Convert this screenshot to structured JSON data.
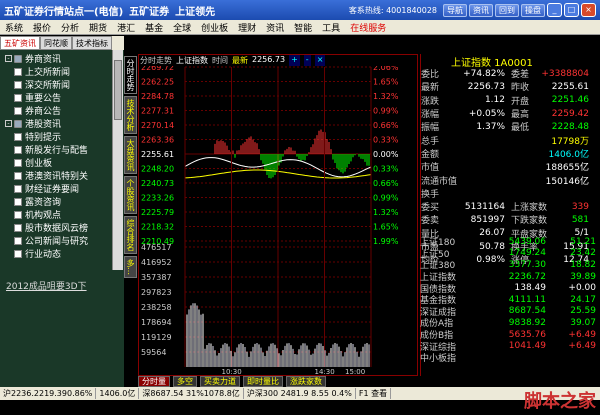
{
  "window": {
    "title_parts": [
      "五矿证券行情站点一(电信)",
      "五矿证券",
      "上证领先"
    ],
    "customer_label": "客系热线: 4001840028",
    "buttons": [
      "导航",
      "资讯",
      "回到",
      "操盘"
    ],
    "controls": [
      "minimize",
      "maximize",
      "close"
    ]
  },
  "menu": [
    "系统",
    "报价",
    "分析",
    "期货",
    "港汇",
    "基金",
    "全球",
    "创业板",
    "理财",
    "资讯",
    "智能",
    "工具",
    "在线服务"
  ],
  "sidebar": {
    "tabs": [
      "五矿资讯",
      "同花顺",
      "技术指标"
    ],
    "items": [
      {
        "label": "券商资讯",
        "type": "group"
      },
      {
        "label": "上交所新闻",
        "type": "sub"
      },
      {
        "label": "深交所新闻",
        "type": "sub"
      },
      {
        "label": "重要公告",
        "type": "sub"
      },
      {
        "label": "券商公告",
        "type": "sub"
      },
      {
        "label": "港股资讯",
        "type": "group"
      },
      {
        "label": "特别提示",
        "type": "sub"
      },
      {
        "label": "新股发行与配售",
        "type": "sub"
      },
      {
        "label": "创业板",
        "type": "sub"
      },
      {
        "label": "港澳资讯特别关",
        "type": "sub"
      },
      {
        "label": "财经证券要闻",
        "type": "sub"
      },
      {
        "label": "露资咨询",
        "type": "sub"
      },
      {
        "label": "机构观点",
        "type": "sub"
      },
      {
        "label": "股市数据风云榜",
        "type": "sub"
      },
      {
        "label": "公司新闻与研究",
        "type": "sub"
      },
      {
        "label": "行业动态",
        "type": "sub"
      }
    ],
    "footer_link": "2012成品咀要3D下"
  },
  "vertical_tabs": [
    "分时走势",
    "技术分析",
    "大盘资讯",
    "个股资讯",
    "综合排名",
    "多…"
  ],
  "chart_header": {
    "label1": "分时走势",
    "symbol": "上证指数",
    "time": "时间",
    "value_label": "最新",
    "value": "2256.73",
    "buttons": [
      "+",
      "-",
      "×"
    ]
  },
  "chart_data": {
    "type": "line",
    "y_ticks_price": [
      "2269.72",
      "2262.25",
      "2284.78",
      "2277.31",
      "2270.14",
      "2263.36",
      "2255.61",
      "2248.20",
      "2240.73",
      "2233.26",
      "2225.79",
      "2218.32",
      "2210.49"
    ],
    "y_ticks_pct": [
      "2.06%",
      "1.65%",
      "1.32%",
      "0.99%",
      "0.66%",
      "0.33%",
      "0.00%",
      "0.33%",
      "0.66%",
      "0.99%",
      "1.32%",
      "1.65%",
      "1.99%"
    ],
    "vol_ticks": [
      "476517",
      "416952",
      "357387",
      "297823",
      "238258",
      "178694",
      "119129",
      "59564"
    ],
    "x_ticks": [
      "10:30",
      "14:30",
      "15:00"
    ],
    "base_price": 2255.61
  },
  "bottom_tabs": [
    "分时量",
    "多空",
    "买卖力道",
    "即时量比",
    "涨跌家数"
  ],
  "quote": {
    "title": "上证指数 1A0001",
    "rows": [
      {
        "k": "委比",
        "v": "+74.82%",
        "v_color": "red",
        "k2": "委差",
        "v2": "+3388804",
        "v2_color": "red"
      },
      {
        "k": "最新",
        "v": "2256.73",
        "v_color": "white",
        "k2": "昨收",
        "v2": "2255.61",
        "v2_color": "white"
      },
      {
        "k": "涨跌",
        "v": "1.12",
        "v_color": "red",
        "k2": "开盘",
        "v2": "2251.46",
        "v2_color": "green"
      },
      {
        "k": "涨幅",
        "v": "+0.05%",
        "v_color": "red",
        "k2": "最高",
        "v2": "2259.42",
        "v2_color": "red"
      },
      {
        "k": "振幅",
        "v": "1.37%",
        "v_color": "white",
        "k2": "最低",
        "v2": "2228.48",
        "v2_color": "green"
      },
      {
        "k": "总手",
        "v": "",
        "v_color": "white",
        "k2": "",
        "v2": "17798万",
        "v2_color": "yel"
      },
      {
        "k": "金额",
        "v": "",
        "v_color": "white",
        "k2": "",
        "v2": "1406.0亿",
        "v2_color": "cyan"
      },
      {
        "k": "市值",
        "v": "",
        "v_color": "white",
        "k2": "",
        "v2": "188655亿",
        "v2_color": "white"
      },
      {
        "k": "流通市值",
        "v": "",
        "v_color": "white",
        "k2": "",
        "v2": "150146亿",
        "v2_color": "white"
      },
      {
        "k": "换手",
        "v": "",
        "v_color": "white",
        "k2": "",
        "v2": "",
        "v2_color": "white"
      },
      {
        "k": "委买",
        "v": "5131164",
        "v_color": "yel",
        "k2": "上涨家数",
        "v2": "339",
        "v2_color": "red"
      },
      {
        "k": "委卖",
        "v": "851997",
        "v_color": "yel",
        "k2": "下跌家数",
        "v2": "581",
        "v2_color": "green"
      },
      {
        "k": "量比",
        "v": "26.07",
        "v_color": "cyan",
        "k2": "平盘家数",
        "v2": "5/1",
        "v2_color": "white"
      },
      {
        "k": "市盈",
        "v": "50.78",
        "v_color": "cyan",
        "k2": "换手率",
        "v2": "15.91",
        "v2_color": "white"
      },
      {
        "k": "均价",
        "v": "0.98%",
        "v_color": "white",
        "k2": "涨停",
        "v2": "12.74",
        "v2_color": "white"
      }
    ]
  },
  "index_list": [
    {
      "n": "上证180",
      "p": "5439.06",
      "c": "51.21",
      "color": "green"
    },
    {
      "n": "上证50",
      "p": "1749.24",
      "c": "23.42",
      "color": "green"
    },
    {
      "n": "上证380",
      "p": "3377.30",
      "c": "18.82",
      "color": "green"
    },
    {
      "n": "上证指数",
      "p": "2236.72",
      "c": "39.89",
      "color": "green"
    },
    {
      "n": "国债指数",
      "p": "138.49",
      "c": "+0.00",
      "color": "white"
    },
    {
      "n": "基金指数",
      "p": "4111.11",
      "c": "24.17",
      "color": "green"
    },
    {
      "n": "深证成指",
      "p": "8687.54",
      "c": "25.59",
      "color": "green"
    },
    {
      "n": "成份A指",
      "p": "9838.92",
      "c": "39.07",
      "color": "green"
    },
    {
      "n": "成份B指",
      "p": "5635.76",
      "c": "+6.49",
      "color": "red"
    },
    {
      "n": "深证综指",
      "p": "1041.49",
      "c": "+6.49",
      "color": "red"
    },
    {
      "n": "中小板指",
      "p": "",
      "c": "",
      "color": "white"
    }
  ],
  "section_tag": "指数",
  "status": [
    "沪2236.2219.390.86%",
    "1406.0亿",
    "深8687.54 31%1078.8亿",
    "沪深300 2481.9 8.55 0.4%",
    "F1 查看"
  ],
  "watermark": "脚本之家"
}
